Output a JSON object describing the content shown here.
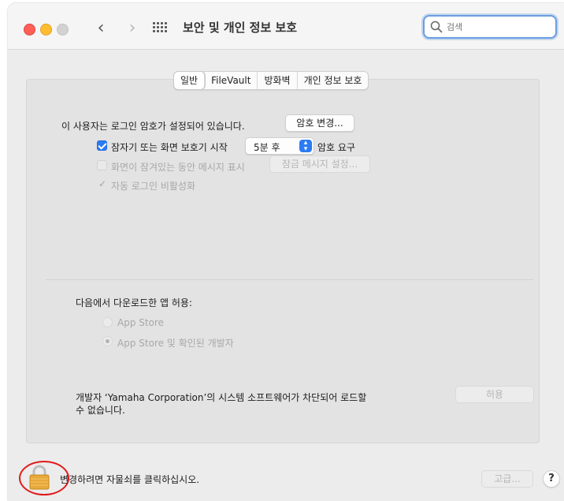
{
  "window": {
    "title": "보안 및 개인 정보 보호",
    "nav_back": "‹",
    "nav_forward": "›"
  },
  "search": {
    "placeholder": "검색"
  },
  "tabs": [
    {
      "label": "일반",
      "active": true
    },
    {
      "label": "FileVault",
      "active": false
    },
    {
      "label": "방화벽",
      "active": false
    },
    {
      "label": "개인 정보 보호",
      "active": false
    }
  ],
  "general": {
    "password_status": "이 사용자는 로그인 암호가 설정되어 있습니다.",
    "change_password_button": "암호 변경...",
    "require_password": {
      "label": "잠자기 또는 화면 보호기 시작",
      "checked": true,
      "delay_value": "5분 후",
      "suffix": "암호 요구"
    },
    "show_message": {
      "label": "화면이 잠겨있는 동안 메시지 표시",
      "checked": false,
      "button": "잠금 메시지 설정..."
    },
    "disable_auto_login": {
      "label": "자동 로그인 비활성화",
      "checked": true
    }
  },
  "downloads": {
    "heading": "다음에서 다운로드한 앱 허용:",
    "options": [
      {
        "label": "App Store",
        "selected": false
      },
      {
        "label": "App Store 및 확인된 개발자",
        "selected": true
      }
    ]
  },
  "blocked": {
    "message_line1": "개발자 ‘Yamaha Corporation’의 시스템 소프트웨어가 차단되어 로드할",
    "message_line2": "수 없습니다.",
    "allow_button": "허용"
  },
  "footer": {
    "lock_text": "변경하려면 자물쇠를 클릭하십시오.",
    "advanced_button": "고급...",
    "help_button": "?"
  },
  "colors": {
    "accent": "#2b7bf5",
    "annotation": "#e01b1b",
    "lock": "#e8a93a"
  },
  "icons": [
    "search-icon",
    "grid-icon",
    "lock-icon",
    "chevron-left-icon",
    "chevron-right-icon"
  ]
}
